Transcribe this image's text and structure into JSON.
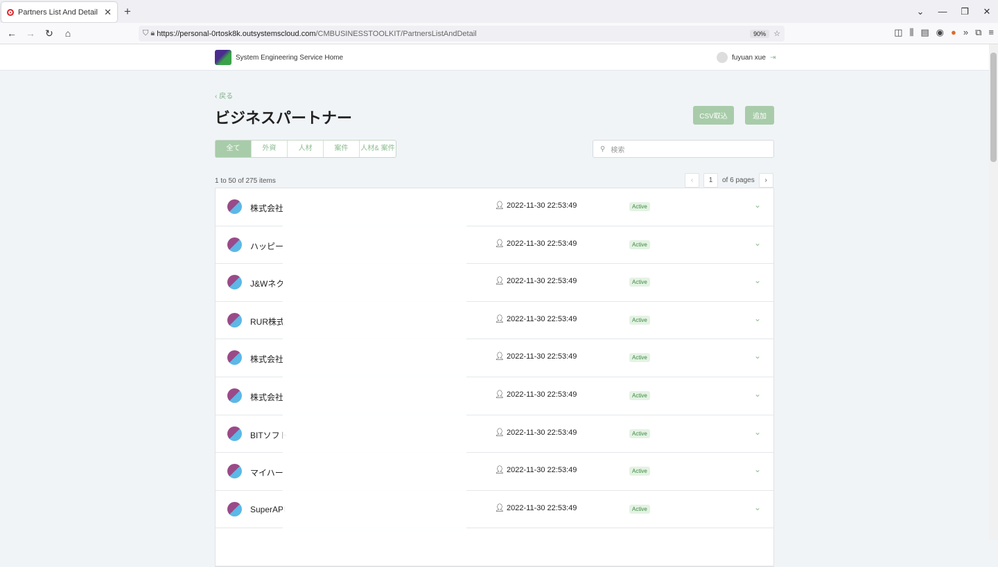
{
  "browser": {
    "tab_title": "Partners List And Detail",
    "url_host": "https://personal-0rtosk8k.outsystemscloud.com",
    "url_path": "/CMBUSINESSTOOLKIT/PartnersListAndDetail",
    "zoom": "90%"
  },
  "app": {
    "title": "System Engineering Service Home",
    "user": "fuyuan xue"
  },
  "page": {
    "back": "‹ 戻る",
    "title": "ビジネスパートナー",
    "csv_button": "CSV取込",
    "add_button": "追加",
    "search_placeholder": "検索",
    "filters": [
      "全て",
      "外資",
      "人材",
      "案件",
      "人材& 案件"
    ],
    "count": "1 to 50 of 275 items",
    "page_current": "1",
    "page_of": "of 6 pages"
  },
  "rows": [
    {
      "name": "株式会社",
      "updated": "2022-11-30 22:53:49",
      "status": "Active"
    },
    {
      "name": "ハッピー",
      "updated": "2022-11-30 22:53:49",
      "status": "Active"
    },
    {
      "name": "J&Wネク",
      "updated": "2022-11-30 22:53:49",
      "status": "Active"
    },
    {
      "name": "RUR株式",
      "updated": "2022-11-30 22:53:49",
      "status": "Active"
    },
    {
      "name": "株式会社",
      "updated": "2022-11-30 22:53:49",
      "status": "Active"
    },
    {
      "name": "株式会社",
      "updated": "2022-11-30 22:53:49",
      "status": "Active"
    },
    {
      "name": "BITソフト",
      "updated": "2022-11-30 22:53:49",
      "status": "Active"
    },
    {
      "name": "マイハー",
      "updated": "2022-11-30 22:53:49",
      "status": "Active"
    },
    {
      "name": "SuperAPI",
      "updated": "2022-11-30 22:53:49",
      "status": "Active"
    }
  ]
}
